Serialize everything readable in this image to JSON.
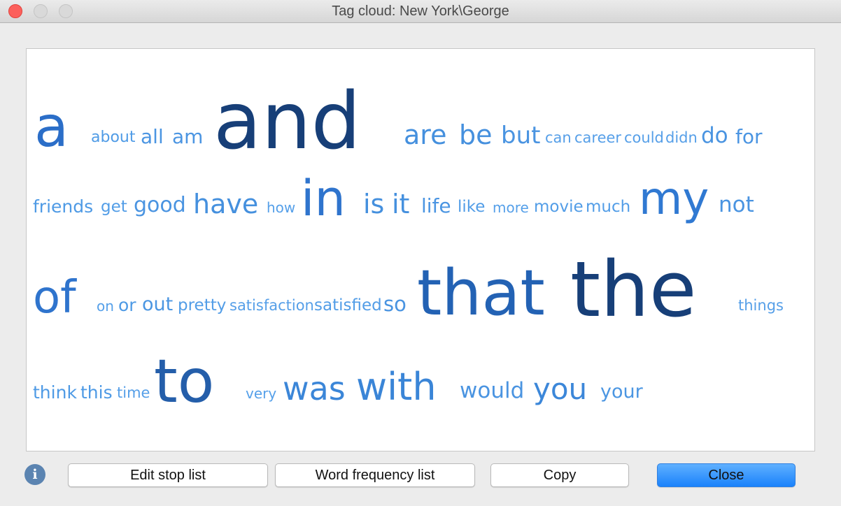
{
  "window": {
    "title": "Tag cloud: New York\\George"
  },
  "cloud": {
    "words": [
      {
        "text": "a",
        "size": 80,
        "color": "#2b6ec8"
      },
      {
        "text": "about",
        "size": 22,
        "color": "#4f9be6"
      },
      {
        "text": "all",
        "size": 28,
        "color": "#4b95e2"
      },
      {
        "text": "am",
        "size": 28,
        "color": "#4b95e2"
      },
      {
        "text": "and",
        "size": 112,
        "color": "#173f78"
      },
      {
        "text": "are",
        "size": 38,
        "color": "#4590de"
      },
      {
        "text": "be",
        "size": 38,
        "color": "#4590de"
      },
      {
        "text": "but",
        "size": 34,
        "color": "#4a94e1"
      },
      {
        "text": "can",
        "size": 21,
        "color": "#569fe8"
      },
      {
        "text": "career",
        "size": 21,
        "color": "#569fe8"
      },
      {
        "text": "could",
        "size": 21,
        "color": "#569fe8"
      },
      {
        "text": "didn",
        "size": 21,
        "color": "#569fe8"
      },
      {
        "text": "do",
        "size": 31,
        "color": "#4a94e1"
      },
      {
        "text": "for",
        "size": 28,
        "color": "#4b95e2"
      },
      {
        "text": "friends",
        "size": 25,
        "color": "#4e9ae5"
      },
      {
        "text": "get",
        "size": 23,
        "color": "#529de7"
      },
      {
        "text": "good",
        "size": 30,
        "color": "#4a94e1"
      },
      {
        "text": "have",
        "size": 38,
        "color": "#4590de"
      },
      {
        "text": "how",
        "size": 20,
        "color": "#56a0e9"
      },
      {
        "text": "in",
        "size": 70,
        "color": "#2f74cd"
      },
      {
        "text": "is",
        "size": 38,
        "color": "#4590de"
      },
      {
        "text": "it",
        "size": 38,
        "color": "#4590de"
      },
      {
        "text": "life",
        "size": 28,
        "color": "#4b95e2"
      },
      {
        "text": "like",
        "size": 23,
        "color": "#529de7"
      },
      {
        "text": "more",
        "size": 20,
        "color": "#56a0e9"
      },
      {
        "text": "movie",
        "size": 23,
        "color": "#529de7"
      },
      {
        "text": "much",
        "size": 23,
        "color": "#529de7"
      },
      {
        "text": "my",
        "size": 64,
        "color": "#3079d2"
      },
      {
        "text": "not",
        "size": 31,
        "color": "#4a94e1"
      },
      {
        "text": "of",
        "size": 64,
        "color": "#2f74cd"
      },
      {
        "text": "on",
        "size": 20,
        "color": "#56a0e9"
      },
      {
        "text": "or",
        "size": 25,
        "color": "#4e9ae5"
      },
      {
        "text": "out",
        "size": 27,
        "color": "#4b96e2"
      },
      {
        "text": "pretty",
        "size": 23,
        "color": "#529de7"
      },
      {
        "text": "satisfaction",
        "size": 21,
        "color": "#569fe8"
      },
      {
        "text": "satisfied",
        "size": 23,
        "color": "#529de7"
      },
      {
        "text": "so",
        "size": 29,
        "color": "#4a94e1"
      },
      {
        "text": "that",
        "size": 90,
        "color": "#2362b4"
      },
      {
        "text": "the",
        "size": 110,
        "color": "#173f78"
      },
      {
        "text": "things",
        "size": 21,
        "color": "#569fe8"
      },
      {
        "text": "think",
        "size": 25,
        "color": "#4e9ae5"
      },
      {
        "text": "this",
        "size": 25,
        "color": "#4e9ae5"
      },
      {
        "text": "time",
        "size": 21,
        "color": "#569fe8"
      },
      {
        "text": "to",
        "size": 86,
        "color": "#245eaa"
      },
      {
        "text": "very",
        "size": 20,
        "color": "#56a0e9"
      },
      {
        "text": "was",
        "size": 46,
        "color": "#3b86d8"
      },
      {
        "text": "with",
        "size": 54,
        "color": "#3a85d7"
      },
      {
        "text": "would",
        "size": 31,
        "color": "#4a94e1"
      },
      {
        "text": "you",
        "size": 42,
        "color": "#3c87d9"
      },
      {
        "text": "your",
        "size": 27,
        "color": "#4b96e2"
      }
    ]
  },
  "buttons": {
    "edit_stop_list": "Edit stop list",
    "word_frequency_list": "Word frequency list",
    "copy": "Copy",
    "close": "Close"
  },
  "info_icon": {
    "glyph": "i",
    "icon": "info-icon"
  }
}
